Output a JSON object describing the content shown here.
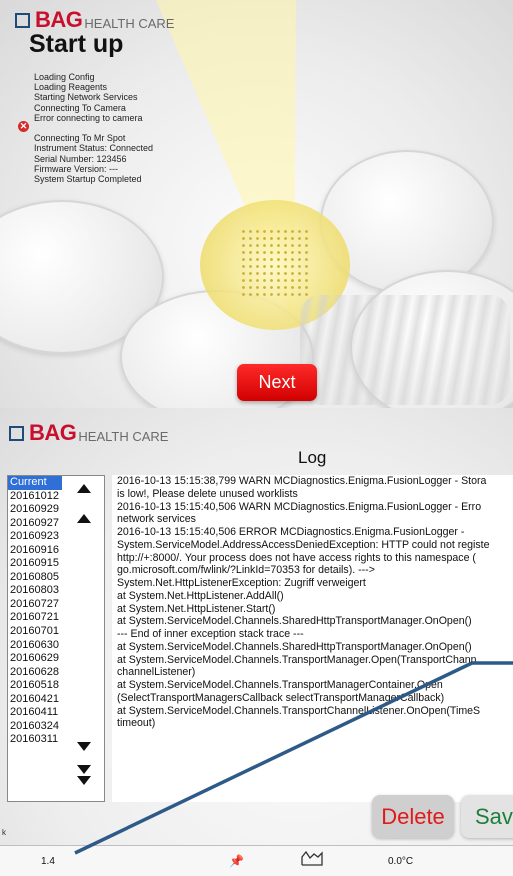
{
  "brand": {
    "bag": "BAG",
    "healthcare": "HEALTH CARE"
  },
  "startup": {
    "title": "Start up",
    "messages": [
      "Loading Config",
      "Loading Reagents",
      "Starting Network Services",
      "Connecting To Camera",
      "Error connecting to camera",
      "",
      "Connecting To Mr Spot",
      "Instrument Status: Connected",
      "Serial Number: 123456",
      "Firmware Version: ---",
      "System Startup Completed"
    ],
    "next_label": "Next"
  },
  "log": {
    "title": "Log",
    "dates": [
      "Current",
      "20161012",
      "20160929",
      "20160927",
      "20160923",
      "20160916",
      "20160915",
      "20160805",
      "20160803",
      "20160727",
      "20160721",
      "20160701",
      "20160630",
      "20160629",
      "20160628",
      "20160518",
      "20160421",
      "20160411",
      "20160324",
      "20160311"
    ],
    "selected": "Current",
    "lines": [
      "2016-10-13 15:15:38,799 WARN MCDiagnostics.Enigma.FusionLogger - Stora",
      "is low!, Please delete unused worklists",
      "2016-10-13 15:15:40,506 WARN MCDiagnostics.Enigma.FusionLogger - Erro",
      "network services",
      "2016-10-13 15:15:40,506 ERROR MCDiagnostics.Enigma.FusionLogger -",
      "System.ServiceModel.AddressAccessDeniedException: HTTP could not registe",
      "http://+:8000/. Your process does not have access rights to this namespace (",
      "go.microsoft.com/fwlink/?LinkId=70353 for details). --->",
      "System.Net.HttpListenerException: Zugriff verweigert",
      "   at System.Net.HttpListener.AddAll()",
      "   at System.Net.HttpListener.Start()",
      "   at System.ServiceModel.Channels.SharedHttpTransportManager.OnOpen()",
      "   --- End of inner exception stack trace ---",
      "   at System.ServiceModel.Channels.SharedHttpTransportManager.OnOpen()",
      "   at System.ServiceModel.Channels.TransportManager.Open(TransportChann",
      "channelListener)",
      "   at System.ServiceModel.Channels.TransportManagerContainer.Open",
      "(SelectTransportManagersCallback selectTransportManagerCallback)",
      "   at System.ServiceModel.Channels.TransportChannelListener.OnOpen(TimeS",
      "timeout)"
    ],
    "delete_label": "Delete",
    "save_label": "Sav"
  },
  "statusbar": {
    "version": "1.4",
    "temperature": "0.0°C"
  },
  "edge_text": "k",
  "icons": {
    "error": "error-icon",
    "pin": "pin-icon",
    "chart": "chart-icon",
    "scroll_up": "scroll-up-icon",
    "scroll_down": "scroll-down-icon"
  },
  "colors": {
    "brand_red": "#c8102e",
    "brand_blue": "#1e4c7a",
    "next_red": "#e00000",
    "selection_blue": "#2f6fd6",
    "delete_red": "#e01a1a",
    "save_green": "#1d7f3a",
    "overlay_line": "#2e5a88"
  }
}
